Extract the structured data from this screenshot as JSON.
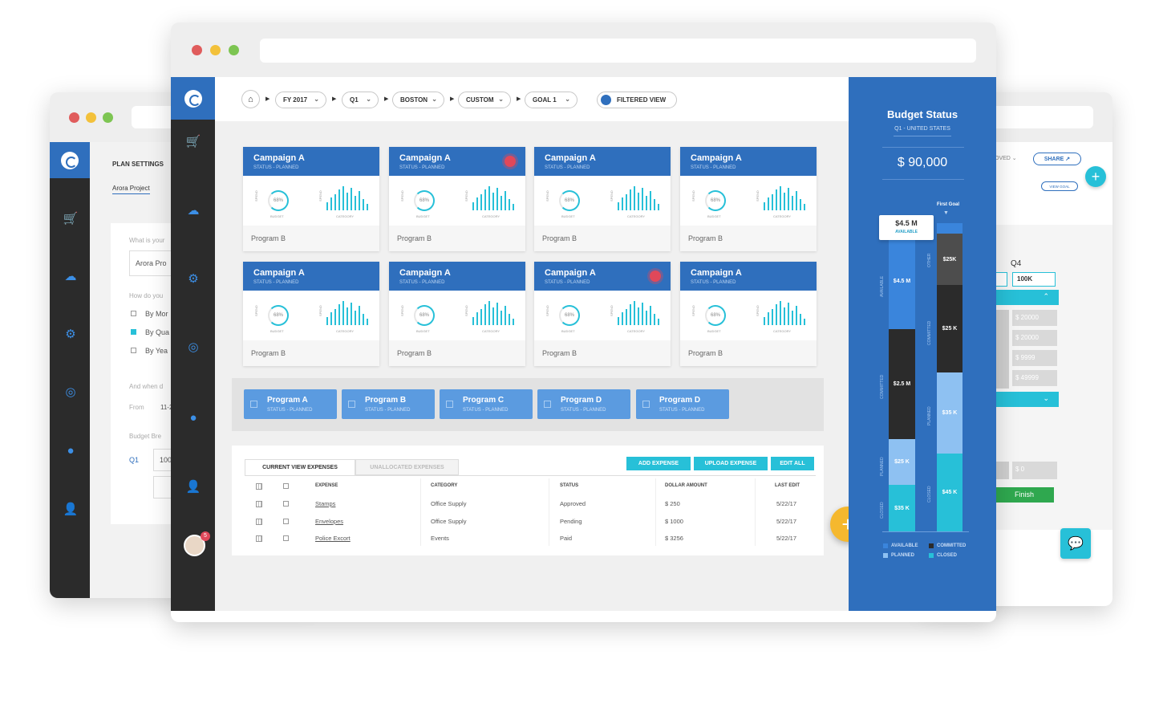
{
  "back_left": {
    "section_title": "PLAN SETTINGS",
    "tab_label": "Arora Project",
    "q_name": "What is your",
    "input_value": "Arora Pro",
    "q_how": "How do you",
    "opt_month": "By Mor",
    "opt_quarter": "By Qua",
    "opt_year": "By Yea",
    "q_when": "And when d",
    "from_label": "From",
    "from_value": "11-2",
    "budget_break": "Budget Bre",
    "q1_label": "Q1",
    "q1_value": "100"
  },
  "back_right": {
    "approved_partial": "OVED",
    "share_label": "SHARE",
    "view_goal_label": "VIEW GOAL",
    "q4_label": "Q4",
    "q4_value": "100K",
    "row_values": [
      "$ 20000",
      "$ 20000",
      "$ 9999",
      "$ 49999"
    ],
    "zero_value": "$ 0",
    "finish_label": "Finish"
  },
  "breadcrumb": {
    "items": [
      "FY 2017",
      "Q1",
      "BOSTON",
      "CUSTOM",
      "GOAL 1"
    ],
    "filtered_view": "FILTERED VIEW"
  },
  "campaigns": [
    {
      "title": "Campaign A",
      "status": "STATUS - PLANNED",
      "percent": "68%",
      "spend": "SPEND",
      "budget": "BUDGET",
      "category": "CATEGORY",
      "program": "Program B",
      "alert": false
    },
    {
      "title": "Campaign A",
      "status": "STATUS - PLANNED",
      "percent": "68%",
      "spend": "SPEND",
      "budget": "BUDGET",
      "category": "CATEGORY",
      "program": "Program B",
      "alert": true
    },
    {
      "title": "Campaign A",
      "status": "STATUS - PLANNED",
      "percent": "68%",
      "spend": "SPEND",
      "budget": "BUDGET",
      "category": "CATEGORY",
      "program": "Program B",
      "alert": false
    },
    {
      "title": "Campaign A",
      "status": "STATUS - PLANNED",
      "percent": "68%",
      "spend": "SPEND",
      "budget": "BUDGET",
      "category": "CATEGORY",
      "program": "Program B",
      "alert": false
    },
    {
      "title": "Campaign A",
      "status": "STATUS - PLANNED",
      "percent": "68%",
      "spend": "SPEND",
      "budget": "BUDGET",
      "category": "CATEGORY",
      "program": "Program B",
      "alert": false
    },
    {
      "title": "Campaign A",
      "status": "STATUS - PLANNED",
      "percent": "68%",
      "spend": "SPEND",
      "budget": "BUDGET",
      "category": "CATEGORY",
      "program": "Program B",
      "alert": false
    },
    {
      "title": "Campaign A",
      "status": "STATUS - PLANNED",
      "percent": "68%",
      "spend": "SPEND",
      "budget": "BUDGET",
      "category": "CATEGORY",
      "program": "Program B",
      "alert": true
    },
    {
      "title": "Campaign A",
      "status": "STATUS - PLANNED",
      "percent": "68%",
      "spend": "SPEND",
      "budget": "BUDGET",
      "category": "CATEGORY",
      "program": "Program B",
      "alert": false
    }
  ],
  "programs": [
    {
      "title": "Program A",
      "status": "STATUS - PLANNED"
    },
    {
      "title": "Program B",
      "status": "STATUS - PLANNED"
    },
    {
      "title": "Program C",
      "status": "STATUS - PLANNED"
    },
    {
      "title": "Program D",
      "status": "STATUS - PLANNED"
    },
    {
      "title": "Program D",
      "status": "STATUS - PLANNED"
    }
  ],
  "expenses": {
    "tab_current": "CURRENT VIEW EXPENSES",
    "tab_unallocated": "UNALLOCATED EXPENSES",
    "btn_add": "ADD EXPENSE",
    "btn_upload": "UPLOAD EXPENSE",
    "btn_edit": "EDIT ALL",
    "columns": [
      "EXPENSE",
      "CATEGORY",
      "STATUS",
      "DOLLAR AMOUNT",
      "LAST EDIT"
    ],
    "rows": [
      {
        "expense": "Stamps",
        "category": "Office Supply",
        "status": "Approved",
        "amount": "$ 250",
        "last_edit": "5/22/17"
      },
      {
        "expense": "Envelopes",
        "category": "Office Supply",
        "status": "Pending",
        "amount": "$ 1000",
        "last_edit": "5/22/17"
      },
      {
        "expense": "Police Excort",
        "category": "Events",
        "status": "Paid",
        "amount": "$ 3256",
        "last_edit": "5/22/17"
      }
    ]
  },
  "notification_count": "5",
  "fab_icon": "plus-icon",
  "budget": {
    "title": "Budget Status",
    "subtitle": "Q1 - UNITED STATES",
    "total": "$ 90,000",
    "first_goal": "First Goal",
    "tooltip_value": "$4.5 M",
    "tooltip_label": "AVAILABLE",
    "col1": [
      {
        "label": "AVAILABLE",
        "value": "$4.5 M"
      },
      {
        "label": "COMMITTED",
        "value": "$2.5 M"
      },
      {
        "label": "PLANNED",
        "value": "$25 K"
      },
      {
        "label": "CLOSED",
        "value": "$35 K"
      }
    ],
    "col2": [
      {
        "label": "OTHER",
        "value": "$25K"
      },
      {
        "label": "COMMITTED",
        "value": "$25 K"
      },
      {
        "label": "PLANNED",
        "value": "$35 K"
      },
      {
        "label": "CLOSED",
        "value": "$45 K"
      }
    ],
    "legend": [
      "AVAILABLE",
      "COMMITTED",
      "PLANNED",
      "CLOSED"
    ]
  },
  "colors": {
    "primary": "#2f6fbd",
    "teal": "#27c0d8",
    "dark": "#2b2b2b",
    "fab": "#f5b82e",
    "alert": "#e0485a",
    "green": "#2fa84f"
  }
}
